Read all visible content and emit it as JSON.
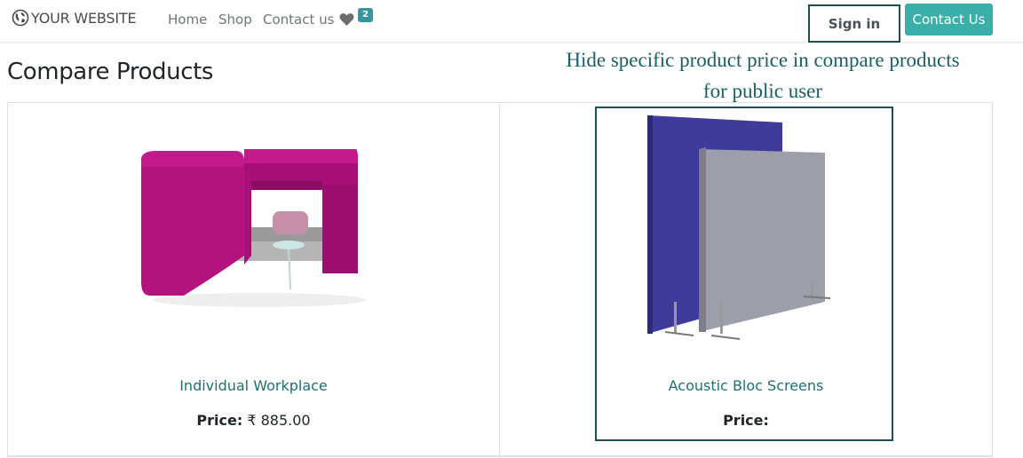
{
  "brand": {
    "name": "YOUR WEBSITE",
    "icon": "globe-icon"
  },
  "nav": {
    "items": [
      {
        "label": "Home"
      },
      {
        "label": "Shop"
      },
      {
        "label": "Contact us"
      }
    ],
    "wishlist": {
      "icon": "heart-icon",
      "count": "2"
    },
    "sign_in": "Sign in",
    "contact_button": "Contact Us"
  },
  "page": {
    "title": "Compare Products",
    "annotation_line1": "Hide specific product price in compare products",
    "annotation_line2": "for public user"
  },
  "products": [
    {
      "name": "Individual Workplace",
      "price_label": "Price:",
      "price_value": "₹ 885.00",
      "image": "magenta-workplace-booth"
    },
    {
      "name": "Acoustic Bloc Screens",
      "price_label": "Price:",
      "price_value": "",
      "image": "acoustic-screen-panels"
    }
  ],
  "colors": {
    "accent": "#3aafa9",
    "badge": "#35979c",
    "link": "#1f6f72",
    "highlight_border": "#1b4f54",
    "annotation": "#1b5e63"
  }
}
